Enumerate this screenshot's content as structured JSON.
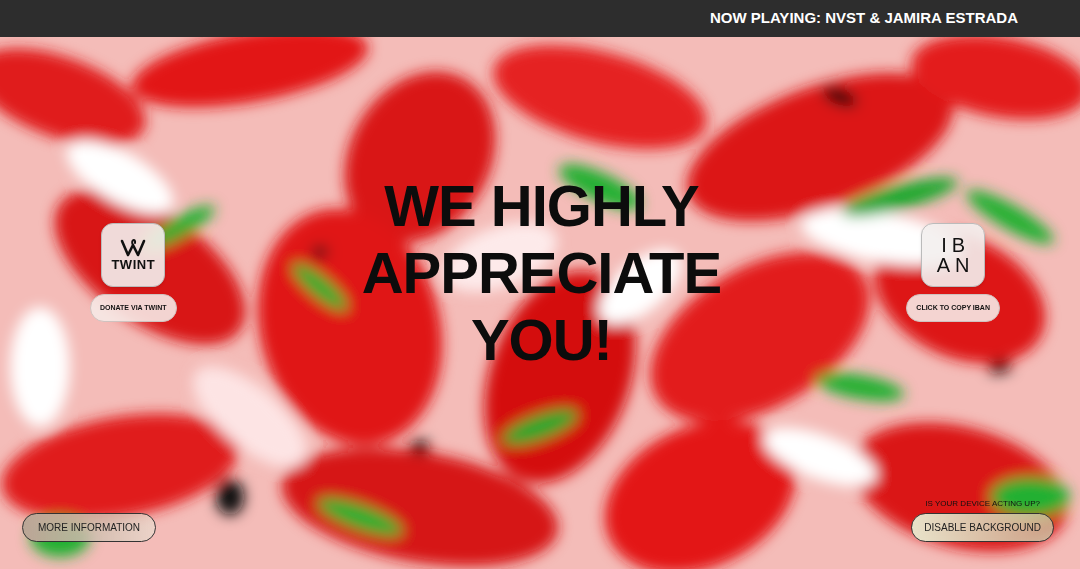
{
  "now_playing": "NOW PLAYING: NVST & JAMIRA ESTRADA",
  "heading": [
    "WE HIGHLY",
    "APPRECIATE",
    "YOU!"
  ],
  "donate_options": [
    {
      "kind": "twint",
      "logo_lines": [
        "TWINT"
      ],
      "button": "DONATE VIA TWINT"
    },
    {
      "kind": "iban",
      "logo_lines": [
        "IB",
        "AN"
      ],
      "button": "CLICK TO COPY IBAN"
    }
  ],
  "more_info_button": "MORE INFORMATION",
  "device_prompt": "IS YOUR DEVICE ACTING UP?",
  "disable_button": "DISABLE BACKGROUND"
}
